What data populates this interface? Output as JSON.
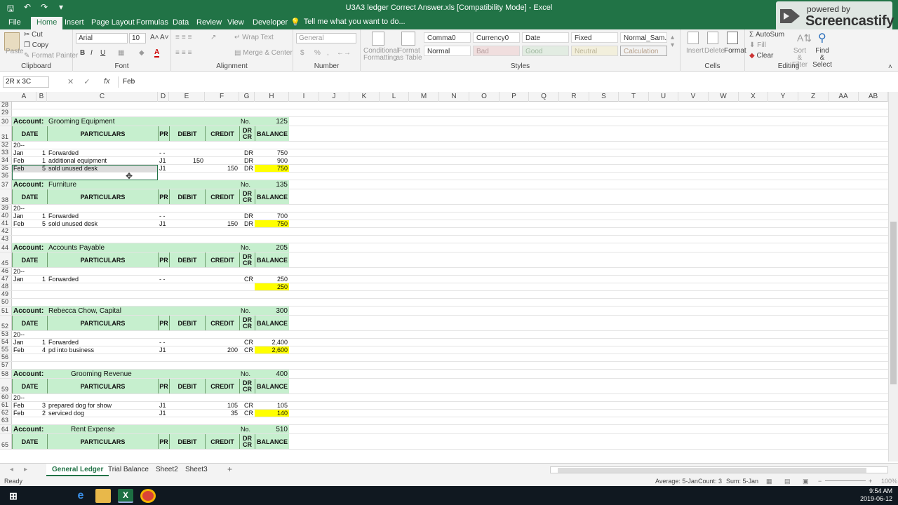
{
  "window": {
    "title": "U3A3 ledger Correct Answer.xls  [Compatibility Mode] - Excel",
    "qat": [
      "save-icon",
      "undo-icon",
      "redo-icon",
      "customize-icon"
    ]
  },
  "overlay": {
    "powered_by": "powered by",
    "brand": "Screencastify"
  },
  "ribbon_tabs": [
    "File",
    "Home",
    "Insert",
    "Page Layout",
    "Formulas",
    "Data",
    "Review",
    "View",
    "Developer"
  ],
  "tell_me": "Tell me what you want to do...",
  "ribbon": {
    "clipboard": {
      "label": "Clipboard",
      "paste": "Paste",
      "cut": "Cut",
      "copy": "Copy",
      "format_painter": "Format Painter"
    },
    "font": {
      "label": "Font",
      "name": "Arial",
      "size": "10",
      "bold": "B",
      "italic": "I",
      "underline": "U"
    },
    "alignment": {
      "label": "Alignment",
      "wrap": "Wrap Text",
      "merge": "Merge & Center"
    },
    "number": {
      "label": "Number",
      "format": "General",
      "currency": "$",
      "percent": "%",
      "comma": ","
    },
    "styles": {
      "label": "Styles",
      "conditional": "Conditional Formatting",
      "format_table": "Format as Table",
      "cells": [
        "Comma0",
        "Currency0",
        "Date",
        "Fixed",
        "Normal_Sam...",
        "Normal",
        "Bad",
        "Good",
        "Neutral",
        "Calculation"
      ]
    },
    "cells": {
      "label": "Cells",
      "insert": "Insert",
      "delete": "Delete",
      "format": "Format"
    },
    "editing": {
      "label": "Editing",
      "autosum": "AutoSum",
      "fill": "Fill",
      "clear": "Clear",
      "sort": "Sort & Filter",
      "find": "Find & Select"
    }
  },
  "formula_bar": {
    "name_box": "2R x 3C",
    "fx": "fx",
    "value": "Feb"
  },
  "columns": [
    "A",
    "B",
    "C",
    "D",
    "E",
    "F",
    "G",
    "H",
    "I",
    "J",
    "K",
    "L",
    "M",
    "N",
    "O",
    "P",
    "Q",
    "R",
    "S",
    "T",
    "U",
    "V",
    "W",
    "X",
    "Y",
    "Z",
    "AA",
    "AB"
  ],
  "ledger_headers": {
    "date": "DATE",
    "particulars": "PARTICULARS",
    "pr": "PR",
    "debit": "DEBIT",
    "credit": "CREDIT",
    "drcr": "DR CR",
    "balance": "BALANCE"
  },
  "rows": [
    {
      "n": "28",
      "type": "blank"
    },
    {
      "n": "29",
      "type": "blank"
    },
    {
      "n": "30",
      "type": "account",
      "label": "Account:",
      "name": "Grooming Equipment",
      "no_label": "No.",
      "no": "125"
    },
    {
      "n": "31",
      "type": "header"
    },
    {
      "n": "32",
      "type": "entry",
      "a": "20--"
    },
    {
      "n": "33",
      "type": "entry",
      "a": "Jan",
      "b": "1",
      "c": "Forwarded",
      "d": "- -",
      "g": "DR",
      "h": "750"
    },
    {
      "n": "34",
      "type": "entry",
      "a": "Feb",
      "b": "1",
      "c": "additional equipment",
      "d": "J1",
      "e": "150",
      "g": "DR",
      "h": "900"
    },
    {
      "n": "35",
      "type": "entry",
      "a": "Feb",
      "b": "5",
      "c": "sold unused desk",
      "d": "J1",
      "f": "150",
      "g": "DR",
      "h": "750",
      "hl": true
    },
    {
      "n": "36",
      "type": "blank"
    },
    {
      "n": "37",
      "type": "account",
      "label": "Account:",
      "name": "Furniture",
      "no_label": "No.",
      "no": "135"
    },
    {
      "n": "38",
      "type": "header"
    },
    {
      "n": "39",
      "type": "entry",
      "a": "20--"
    },
    {
      "n": "40",
      "type": "entry",
      "a": "Jan",
      "b": "1",
      "c": "Forwarded",
      "d": "- -",
      "g": "DR",
      "h": "700"
    },
    {
      "n": "41",
      "type": "entry",
      "a": "Feb",
      "b": "5",
      "c": "sold unused desk",
      "d": "J1",
      "f": "150",
      "g": "DR",
      "h": "750",
      "hl": true
    },
    {
      "n": "42",
      "type": "blank"
    },
    {
      "n": "43",
      "type": "blank"
    },
    {
      "n": "44",
      "type": "account",
      "label": "Account:",
      "name": "Accounts Payable",
      "no_label": "No.",
      "no": "205"
    },
    {
      "n": "45",
      "type": "header"
    },
    {
      "n": "46",
      "type": "entry",
      "a": "20--"
    },
    {
      "n": "47",
      "type": "entry",
      "a": "Jan",
      "b": "1",
      "c": "Forwarded",
      "d": "- -",
      "g": "CR",
      "h": "250"
    },
    {
      "n": "48",
      "type": "entry",
      "h": "250",
      "hl": true
    },
    {
      "n": "49",
      "type": "blank"
    },
    {
      "n": "50",
      "type": "blank"
    },
    {
      "n": "51",
      "type": "account",
      "label": "Account:",
      "name": "Rebecca Chow, Capital",
      "no_label": "No.",
      "no": "300"
    },
    {
      "n": "52",
      "type": "header"
    },
    {
      "n": "53",
      "type": "entry",
      "a": "20--"
    },
    {
      "n": "54",
      "type": "entry",
      "a": "Jan",
      "b": "1",
      "c": "Forwarded",
      "d": "- -",
      "g": "CR",
      "h": "2,400"
    },
    {
      "n": "55",
      "type": "entry",
      "a": "Feb",
      "b": "4",
      "c": "pd into business",
      "d": "J1",
      "f": "200",
      "g": "CR",
      "h": "2,600",
      "hl": true
    },
    {
      "n": "56",
      "type": "blank"
    },
    {
      "n": "57",
      "type": "blank"
    },
    {
      "n": "58",
      "type": "account",
      "label": "Account:",
      "name": "Grooming Revenue",
      "no_label": "No.",
      "no": "400",
      "indent": true
    },
    {
      "n": "59",
      "type": "header"
    },
    {
      "n": "60",
      "type": "entry",
      "a": "20--"
    },
    {
      "n": "61",
      "type": "entry",
      "a": "Feb",
      "b": "3",
      "c": "prepared dog for show",
      "d": "J1",
      "f": "105",
      "g": "CR",
      "h": "105"
    },
    {
      "n": "62",
      "type": "entry",
      "a": "Feb",
      "b": "2",
      "c": "serviced dog",
      "d": "J1",
      "f": "35",
      "g": "CR",
      "h": "140",
      "hl": true
    },
    {
      "n": "63",
      "type": "blank"
    },
    {
      "n": "64",
      "type": "account",
      "label": "Account:",
      "name": "Rent Expense",
      "no_label": "No.",
      "no": "510",
      "indent": true
    },
    {
      "n": "65",
      "type": "header"
    }
  ],
  "sheets": [
    "General Ledger",
    "Trial Balance",
    "Sheet2",
    "Sheet3"
  ],
  "add_sheet": "+",
  "status": {
    "mode": "Ready",
    "average": "Average: 5-Jan",
    "count": "Count: 3",
    "sum": "Sum: 5-Jan",
    "zoom": "100%"
  },
  "clock": {
    "time": "9:54 AM",
    "date": "2019-06-12"
  }
}
